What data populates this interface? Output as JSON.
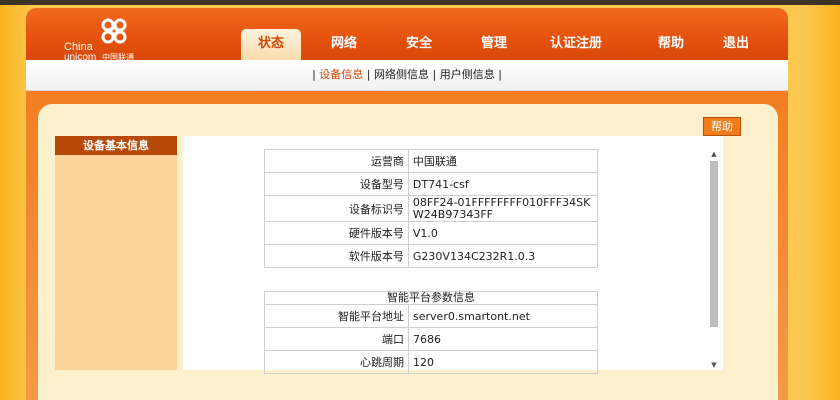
{
  "logo": {
    "line1": "China",
    "line2": "unicom",
    "line3": "中国联通"
  },
  "nav": {
    "tabs": [
      {
        "label": "状态",
        "active": true
      },
      {
        "label": "网络"
      },
      {
        "label": "安全"
      },
      {
        "label": "管理"
      },
      {
        "label": "认证注册"
      },
      {
        "label": "帮助"
      },
      {
        "label": "退出"
      }
    ]
  },
  "subnav": {
    "items": [
      "设备信息",
      "网络侧信息",
      "用户侧信息"
    ],
    "separator": "|"
  },
  "help_button": "帮助",
  "sidebar": {
    "items": [
      {
        "label": "设备基本信息"
      }
    ]
  },
  "device_info": [
    {
      "label": "运营商",
      "value": "中国联通"
    },
    {
      "label": "设备型号",
      "value": "DT741-csf"
    },
    {
      "label": "设备标识号",
      "value": "08FF24-01FFFFFFFF010FFF34SKW24B97343FF"
    },
    {
      "label": "硬件版本号",
      "value": "V1.0"
    },
    {
      "label": "软件版本号",
      "value": "G230V134C232R1.0.3"
    }
  ],
  "platform": {
    "header": "智能平台参数信息",
    "rows": [
      {
        "label": "智能平台地址",
        "value": "server0.smartont.net"
      },
      {
        "label": "端口",
        "value": "7686"
      },
      {
        "label": "心跳周期",
        "value": "120"
      }
    ]
  },
  "colors": {
    "header": "#e5520d",
    "active_text": "#d44a06",
    "sidebar_item": "#b64a0a",
    "cream": "#fdf0cc"
  }
}
